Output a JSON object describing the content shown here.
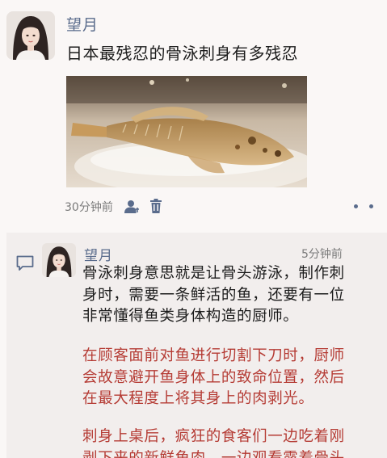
{
  "post": {
    "author": "望月",
    "text": "日本最残忍的骨泳刺身有多残忍",
    "time": "30分钟前"
  },
  "comment": {
    "author": "望月",
    "time": "5分钟前",
    "paragraphs": [
      {
        "color": "#1b1b1b",
        "lines": [
          "骨泳刺身意思就是让骨头游泳，制作刺",
          "身时，需要一条鲜活的鱼，还要有一位",
          "非常懂得鱼类身体构造的厨师。"
        ]
      },
      {
        "color": "#b53b34",
        "lines": [
          "在顾客面前对鱼进行切割下刀时，厨师",
          "会故意避开鱼身体上的致命位置，然后",
          "在最大程度上将其身上的肉剥光。"
        ]
      },
      {
        "color": "#b53b34",
        "lines": [
          "刺身上桌后，疯狂的食客们一边吃着刚",
          "剥下来的新鲜鱼肉，一边观看露着骨头"
        ]
      }
    ]
  }
}
